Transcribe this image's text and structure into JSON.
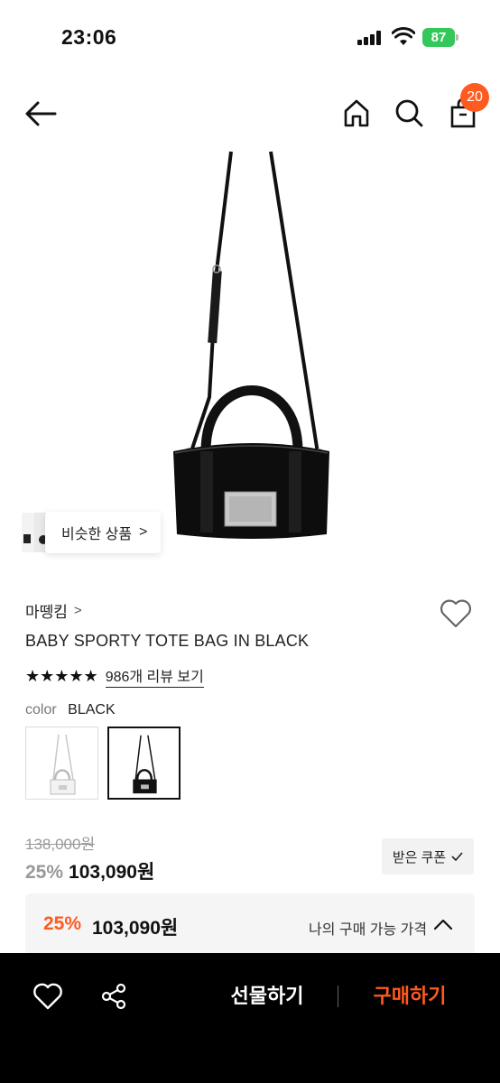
{
  "status_bar": {
    "time": "23:06",
    "battery": "87",
    "battery_color": "#34c759"
  },
  "header": {
    "back_icon": "arrow-left-icon",
    "home_icon": "home-icon",
    "search_icon": "search-icon",
    "cart_icon": "shopping-bag-icon",
    "cart_badge": "20",
    "badge_color": "#ff5a1f"
  },
  "gallery": {
    "similar_label": "비슷한 상품",
    "similar_chevron": ">"
  },
  "product": {
    "brand": "마뗑킴",
    "brand_chevron": ">",
    "name": "BABY SPORTY TOTE BAG IN BLACK",
    "stars": "★★★★★",
    "review_link": "986개 리뷰 보기",
    "color_label": "color",
    "color_value": "BLACK",
    "swatches": [
      {
        "name": "white",
        "selected": false
      },
      {
        "name": "black",
        "selected": true
      }
    ]
  },
  "price": {
    "original": "138,000원",
    "discount": "25%",
    "final": "103,090원",
    "coupon_label": "받은 쿠폰",
    "coupon_icon": "check-icon"
  },
  "my_price": {
    "discount": "25%",
    "price": "103,090원",
    "label": "나의 구매 가능 가격",
    "accent": "#ff5a1f"
  },
  "bottom_bar": {
    "gift_label": "선물하기",
    "buy_label": "구매하기",
    "buy_color": "#ff5a1f"
  }
}
